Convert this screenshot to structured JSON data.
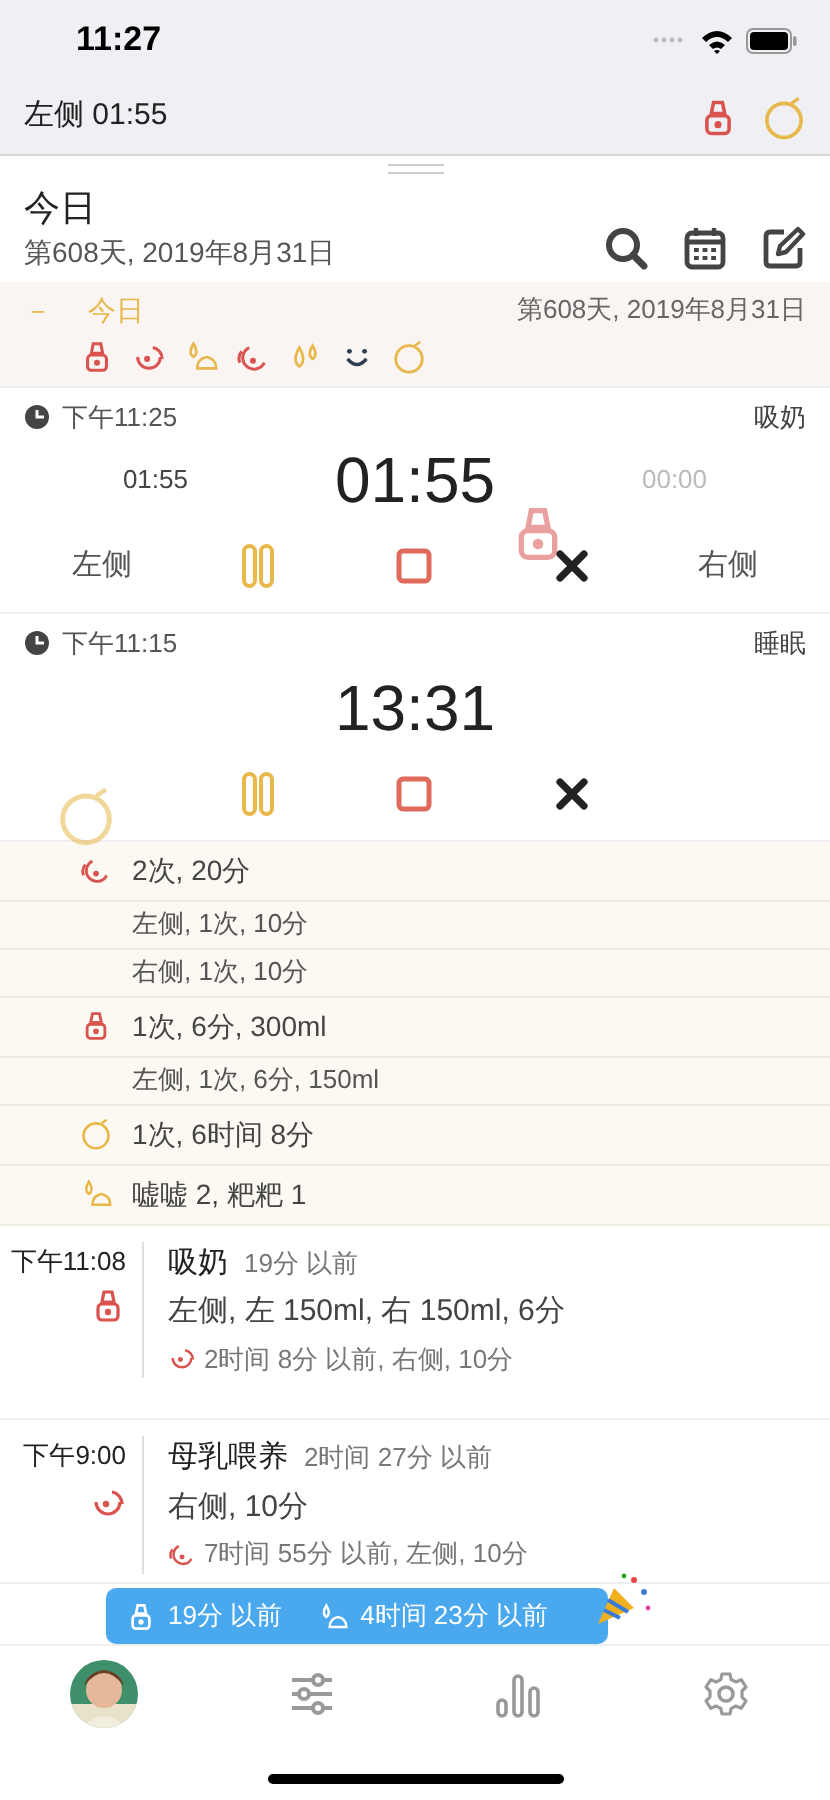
{
  "status_bar": {
    "time": "11:27"
  },
  "active_bar": {
    "label": "左侧 01:55"
  },
  "header": {
    "title": "今日",
    "subtitle": "第608天, 2019年8月31日"
  },
  "day_row": {
    "toggle": "－",
    "title": "今日",
    "date": "第608天, 2019年8月31日",
    "expanded": true,
    "icons": [
      {
        "kind": "pump"
      },
      {
        "kind": "breast"
      },
      {
        "kind": "diaper"
      },
      {
        "kind": "breast2"
      },
      {
        "kind": "drops"
      },
      {
        "kind": "smile"
      },
      {
        "kind": "baby"
      }
    ]
  },
  "timers": [
    {
      "time": "下午11:25",
      "type": "吸奶",
      "left": "01:55",
      "main": "01:55",
      "right": "00:00",
      "left_label": "左侧",
      "right_label": "右侧",
      "deco": {
        "kind": "pump"
      }
    },
    {
      "time": "下午11:15",
      "type": "睡眠",
      "main": "13:31",
      "deco": {
        "kind": "baby"
      }
    }
  ],
  "summary": [
    {
      "kind": "main",
      "icon": {
        "kind": "breast2"
      },
      "text": "2次, 20分"
    },
    {
      "kind": "sub",
      "text": "左侧, 1次, 10分"
    },
    {
      "kind": "sub",
      "text": "右侧, 1次, 10分"
    },
    {
      "kind": "main",
      "icon": {
        "kind": "pump"
      },
      "text": "1次, 6分, 300ml"
    },
    {
      "kind": "sub",
      "text": "左侧, 1次, 6分, 150ml"
    },
    {
      "kind": "main",
      "icon": {
        "kind": "baby"
      },
      "text": "1次, 6时间 8分"
    },
    {
      "kind": "main",
      "icon": {
        "kind": "diaper"
      },
      "text": "嘘嘘 2, 粑粑 1"
    }
  ],
  "entries": [
    {
      "time": "下午11:08",
      "icon": {
        "kind": "pump"
      },
      "title": "吸奶",
      "ago": "19分 以前",
      "detail": "左侧, 左 150ml, 右 150ml, 6分",
      "note_icon": {
        "kind": "breast"
      },
      "note": "2时间 8分 以前, 右侧, 10分"
    },
    {
      "time": "下午9:00",
      "icon": {
        "kind": "breast"
      },
      "title": "母乳喂养",
      "ago": "2时间 27分 以前",
      "detail": "右侧, 10分",
      "note_icon": {
        "kind": "breast2"
      },
      "note": "7时间 55分 以前, 左侧, 10分"
    }
  ],
  "toast": {
    "items": [
      {
        "kind": "pump",
        "text": "19分 以前"
      },
      {
        "kind": "diaper",
        "text": "4时间 23分 以前"
      }
    ]
  }
}
